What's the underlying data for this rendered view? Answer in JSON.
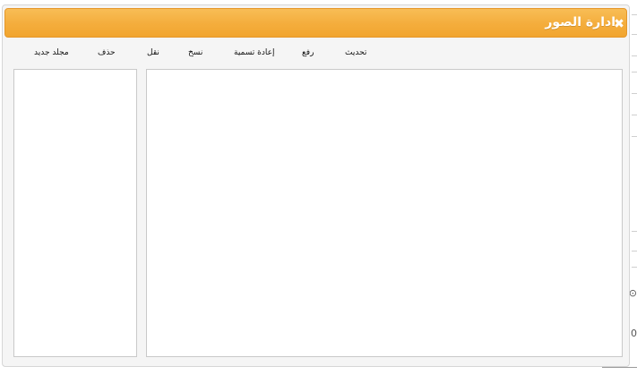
{
  "dialog": {
    "title": "ادارة الصور",
    "close_icon": "close-icon"
  },
  "toolbar": {
    "refresh_label": "تحديث",
    "upload_label": "رفع",
    "rename_label": "إعادة تسمية",
    "copy_label": "نسخ",
    "move_label": "نقل",
    "delete_label": "حذف",
    "new_folder_label": "مجلد جديد"
  },
  "colors": {
    "titlebar": "#f4ad3c",
    "title_text": "#ffffff",
    "dialog_bg": "#f5f5f5",
    "panel_bg": "#ffffff"
  },
  "background_edge": {
    "glyph_1": "⊙",
    "glyph_2": "0"
  }
}
